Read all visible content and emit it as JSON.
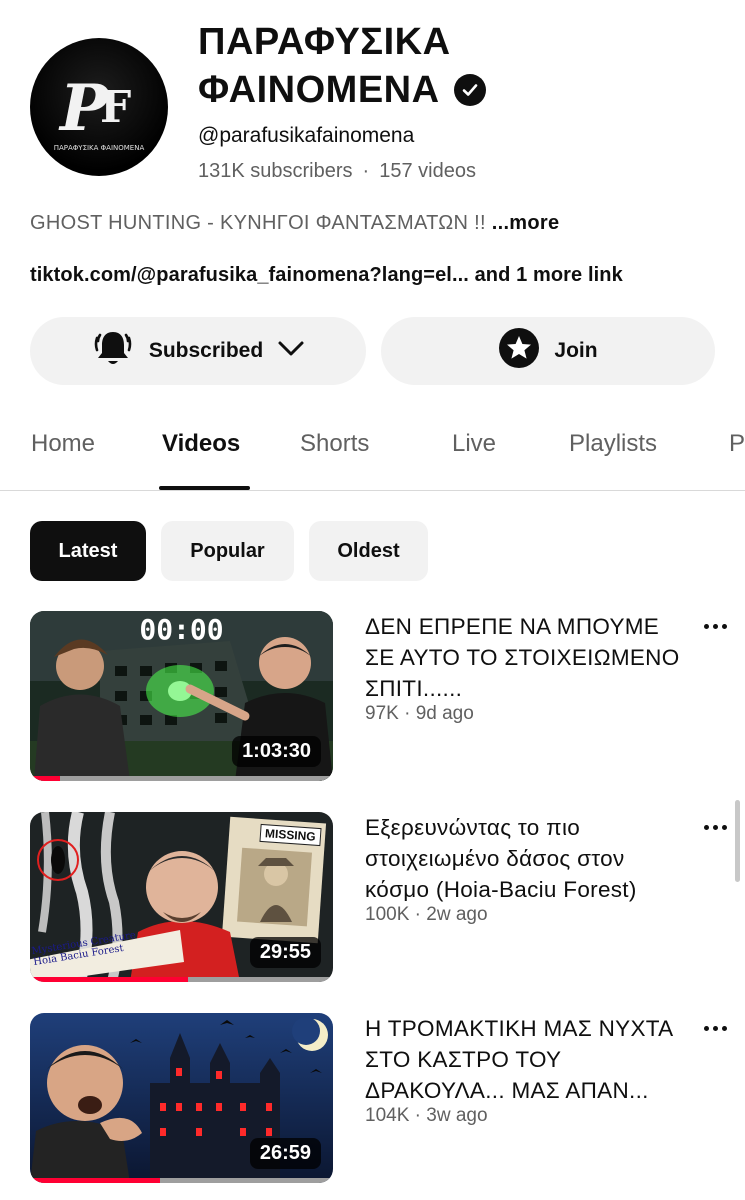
{
  "channel": {
    "name_line1": "ΠΑΡΑΦΥΣΙΚΑ",
    "name_line2": "ΦΑΙΝΟΜΕΝΑ",
    "handle": "@parafusikafainomena",
    "subscribers": "131K subscribers",
    "videos_count": "157 videos",
    "description": "GHOST HUNTING - ΚΥΝΗΓΟΙ ΦΑΝΤΑΣΜΑΤΩΝ !!",
    "more_label": "...more",
    "links_text": "tiktok.com/@parafusika_fainomena?lang=el... and 1 more link",
    "avatar": {
      "logo_text": "Pf",
      "caption": "ΠΑΡΑΦΥΣΙΚΑ ΦΑΙΝΟΜΕΝΑ"
    }
  },
  "actions": {
    "subscribed_label": "Subscribed",
    "join_label": "Join"
  },
  "tabs": [
    {
      "label": "Home"
    },
    {
      "label": "Videos"
    },
    {
      "label": "Shorts"
    },
    {
      "label": "Live"
    },
    {
      "label": "Playlists"
    },
    {
      "label": "P"
    }
  ],
  "active_tab": "Videos",
  "filters": [
    {
      "label": "Latest"
    },
    {
      "label": "Popular"
    },
    {
      "label": "Oldest"
    }
  ],
  "active_filter": "Latest",
  "videos": [
    {
      "title": "ΔΕΝ ΕΠΡΕΠΕ ΝΑ ΜΠΟΥΜΕ ΣΕ ΑΥΤΟ ΤΟ ΣΤΟΙΧΕΙΩΜΕΝΟ ΣΠΙΤΙ......",
      "meta": "97K · 9d ago",
      "duration": "1:03:30",
      "overlay_text": "00:00",
      "watched_fraction": 0.1
    },
    {
      "title": "Εξερευνώντας το πιο στοιχειωμένο δάσος στον κόσμο (Hoia-Baciu Forest)",
      "meta": "100K · 2w ago",
      "duration": "29:55",
      "overlay_text": "MISSING",
      "banner_text": "Mysterious Creature",
      "banner_text2": "Hoia Baciu Forest",
      "watched_fraction": 0.52
    },
    {
      "title": "Η ΤΡΟΜΑΚΤΙΚΗ ΜΑΣ ΝΥΧΤΑ ΣΤΟ ΚΑΣΤΡΟ ΤΟΥ ΔΡΑΚΟΥΛΑ... ΜΑΣ ΑΠΑΝ...",
      "meta": "104K · 3w ago",
      "duration": "26:59",
      "watched_fraction": 0.43
    }
  ],
  "colors": {
    "accent": "#ff0033",
    "text": "#0f0f0f",
    "secondary": "#606060",
    "chip_bg": "#f2f2f2"
  }
}
